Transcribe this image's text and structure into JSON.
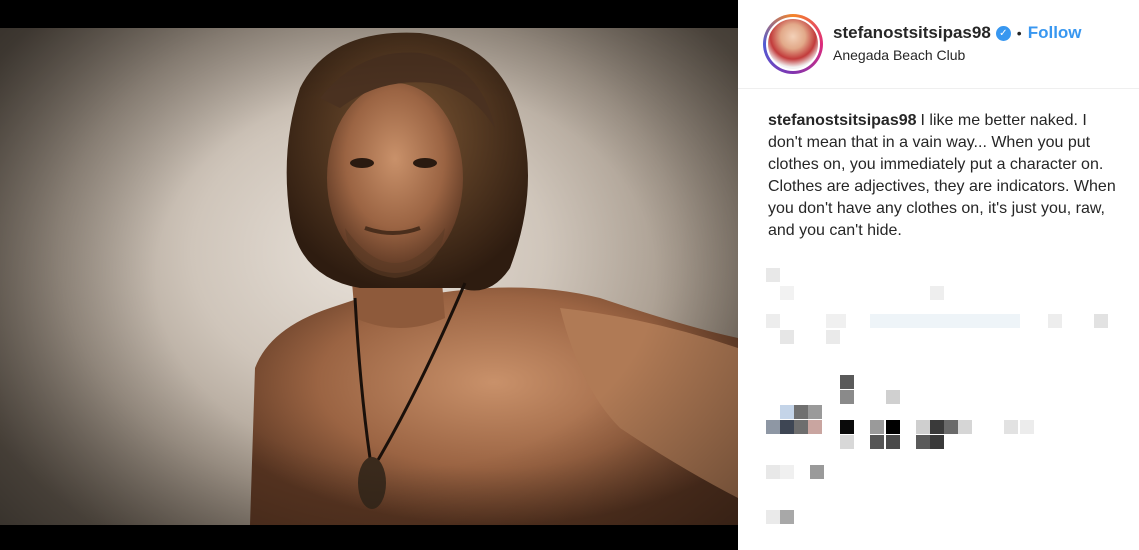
{
  "post": {
    "username": "stefanostsitsipas98",
    "verified_glyph": "✓",
    "separator": "•",
    "follow_label": "Follow",
    "location": "Anegada Beach Club",
    "caption_text": "I like me better naked. I don't mean that in a vain way... When you put clothes on, you immediately put a character on. Clothes are adjectives, they are indicators. When you don't have any clothes on, it's just you, raw, and you can't hide."
  },
  "colors": {
    "accent": "#3897f0",
    "text": "#262626",
    "photo_background": "#000000"
  },
  "icons": {
    "verified": "verified-badge-icon"
  }
}
